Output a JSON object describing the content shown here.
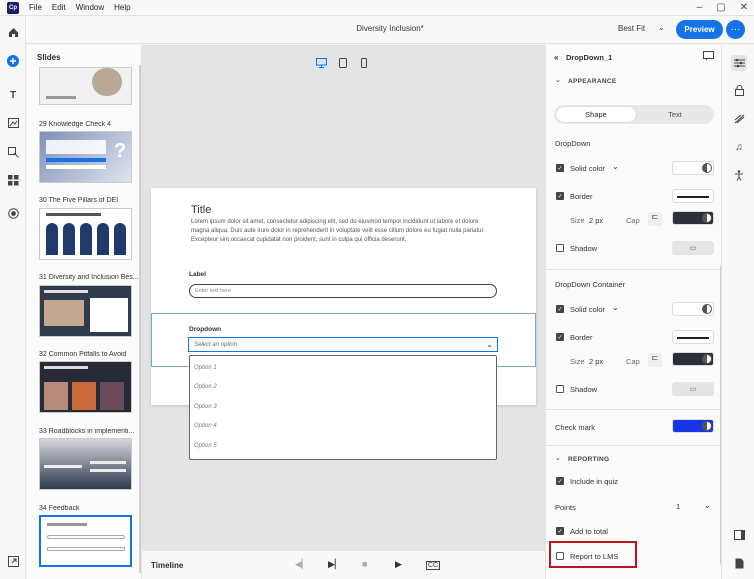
{
  "app": {
    "logo": "Cp",
    "menu": [
      "File",
      "Edit",
      "Window",
      "Help"
    ],
    "doc_title": "Diversity Inclusion*"
  },
  "toolbar": {
    "fit": "Best Fit",
    "preview_label": "Preview",
    "more_label": "···"
  },
  "slides_panel": {
    "header": "Slides",
    "slides": [
      {
        "label": "29  Knowledge Check 4"
      },
      {
        "label": "30  The Five Pillars of DEI"
      },
      {
        "label": "31  Diversity and Inclusion Bes..."
      },
      {
        "label": "32  Common Pitfalls to Avoid"
      },
      {
        "label": "33  Roadblocks in implementi..."
      },
      {
        "label": "34  Feedback"
      }
    ]
  },
  "slide": {
    "title": "Title",
    "body": "Lorem ipsum dolor sit amet, consectetur adipiscing elit, sed do eiusmod tempor incididunt ut labore et dolore magna aliqua. Duis aute irure dolor in reprehenderit in voluptate velit esse cillum dolore eu fugiat nulla pariatur. Excepteur sint occaecat cupidatat non proident, sunt in culpa qui officia deserunt.",
    "label": "Label",
    "input_placeholder": "Enter text here",
    "dropdown_label": "Dropdown",
    "dropdown_placeholder": "Select an option",
    "options": [
      "Option 1",
      "Option 2",
      "Option 3",
      "Option 4",
      "Option 5"
    ]
  },
  "timeline": {
    "label": "Timeline"
  },
  "props": {
    "component_name": "DropDown_1",
    "appearance_header": "APPEARANCE",
    "tab_shape": "Shape",
    "tab_text": "Text",
    "dropdown_section": "DropDown",
    "container_section": "DropDown Container",
    "solid_color": "Solid color",
    "border": "Border",
    "size_label": "Size",
    "size_value": "2 px",
    "cap_label": "Cap",
    "shadow": "Shadow",
    "check_mark": "Check mark",
    "reporting_header": "REPORTING",
    "include_in_quiz": "Include in quiz",
    "points_label": "Points",
    "points_value": "1",
    "add_to_total": "Add to total",
    "report_to_lms": "Report to LMS",
    "colors": {
      "accent": "#1473e6",
      "check_mark_color": "#1537e6",
      "border_swatch": "#2a2f3a",
      "highlight": "#c0141c"
    }
  }
}
